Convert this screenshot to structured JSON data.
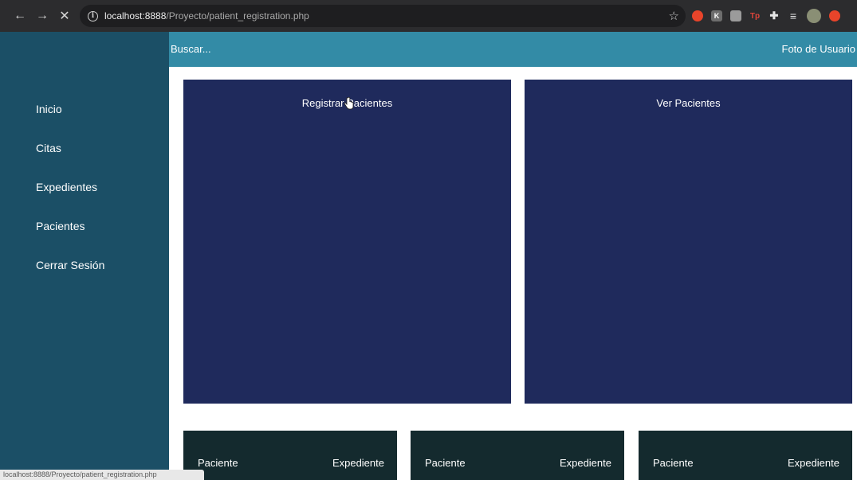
{
  "browser": {
    "url_host": "localhost:8888",
    "url_path": "/Proyecto/patient_registration.php",
    "status_url": "localhost:8888/Proyecto/patient_registration.php",
    "extensions": [
      {
        "name": "red-shield-extension",
        "color": "#e8442a",
        "glyph": "●"
      },
      {
        "name": "gray-box-extension",
        "color": "#6d6d6d",
        "glyph": "K"
      },
      {
        "name": "folder-extension",
        "color": "#9b9b9b",
        "glyph": "▤"
      },
      {
        "name": "tp-extension",
        "color": "#e0463b",
        "glyph": "Tp"
      },
      {
        "name": "puzzle-extension",
        "color": "#cfcfcf",
        "glyph": "✚"
      },
      {
        "name": "playlist-extension",
        "color": "#cfcfcf",
        "glyph": "≡"
      },
      {
        "name": "profile-avatar",
        "color": "#8a8f75",
        "glyph": "●"
      },
      {
        "name": "update-extension",
        "color": "#e8442a",
        "glyph": "●"
      }
    ]
  },
  "topbar": {
    "search": "Buscar...",
    "user_photo": "Foto de Usuario"
  },
  "sidebar": {
    "items": [
      {
        "label": "Inicio"
      },
      {
        "label": "Citas"
      },
      {
        "label": "Expedientes"
      },
      {
        "label": "Pacientes"
      },
      {
        "label": "Cerrar Sesión"
      }
    ]
  },
  "cards": {
    "register": "Registrar Pacientes",
    "view": "Ver Pacientes"
  },
  "records": [
    {
      "left": "Paciente",
      "right": "Expediente"
    },
    {
      "left": "Paciente",
      "right": "Expediente"
    },
    {
      "left": "Paciente",
      "right": "Expediente"
    }
  ],
  "colors": {
    "sidebar": "#1b4f66",
    "topbar": "#338ba6",
    "card": "#1f2a5c",
    "record_card": "#142a2e"
  }
}
